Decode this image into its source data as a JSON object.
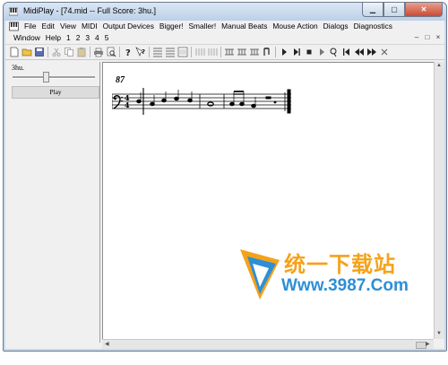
{
  "window": {
    "title": "MidiPlay - [74.mid -- Full Score: 3hu.]",
    "caption_buttons": [
      "minimize",
      "maximize",
      "close"
    ]
  },
  "menubar": {
    "row1": [
      "File",
      "Edit",
      "View",
      "MIDI",
      "Output Devices",
      "Bigger!",
      "Smaller!",
      "Manual Beats",
      "Mouse Action",
      "Dialogs",
      "Diagnostics"
    ],
    "row2": [
      "Window",
      "Help",
      "1",
      "2",
      "3",
      "4",
      "5"
    ],
    "mdi_buttons": [
      "–",
      "□",
      "×"
    ]
  },
  "toolbar": {
    "icons": [
      "new-icon",
      "open-icon",
      "save-icon",
      "cut-icon",
      "copy-icon",
      "paste-icon",
      "print-icon",
      "preview-icon",
      "help-icon",
      "context-help-icon",
      "notes-icon",
      "notes-icon",
      "score-icon",
      "bars-icon",
      "bars-icon",
      "notes-icon",
      "notes-icon",
      "notes-icon",
      "beam-icon",
      "play-icon",
      "play-next-icon",
      "stop-icon",
      "play-icon",
      "loop-icon",
      "first-icon",
      "rewind-icon",
      "forward-icon",
      "close-icon"
    ]
  },
  "left_panel": {
    "score_name": "3hu.",
    "slider_position": 0.4,
    "play_label": "Play"
  },
  "score": {
    "measure_number": "87",
    "time_signature": [
      "4",
      "4"
    ],
    "clef": "bass"
  },
  "watermark": {
    "chinese_text": "统一下载站",
    "url": "Www.3987.Com"
  },
  "colors": {
    "titlebar": "#c9d9ec",
    "watermark_orange": "#f5a21a",
    "watermark_blue": "#2d8fd6",
    "close_button": "#c84a33"
  }
}
